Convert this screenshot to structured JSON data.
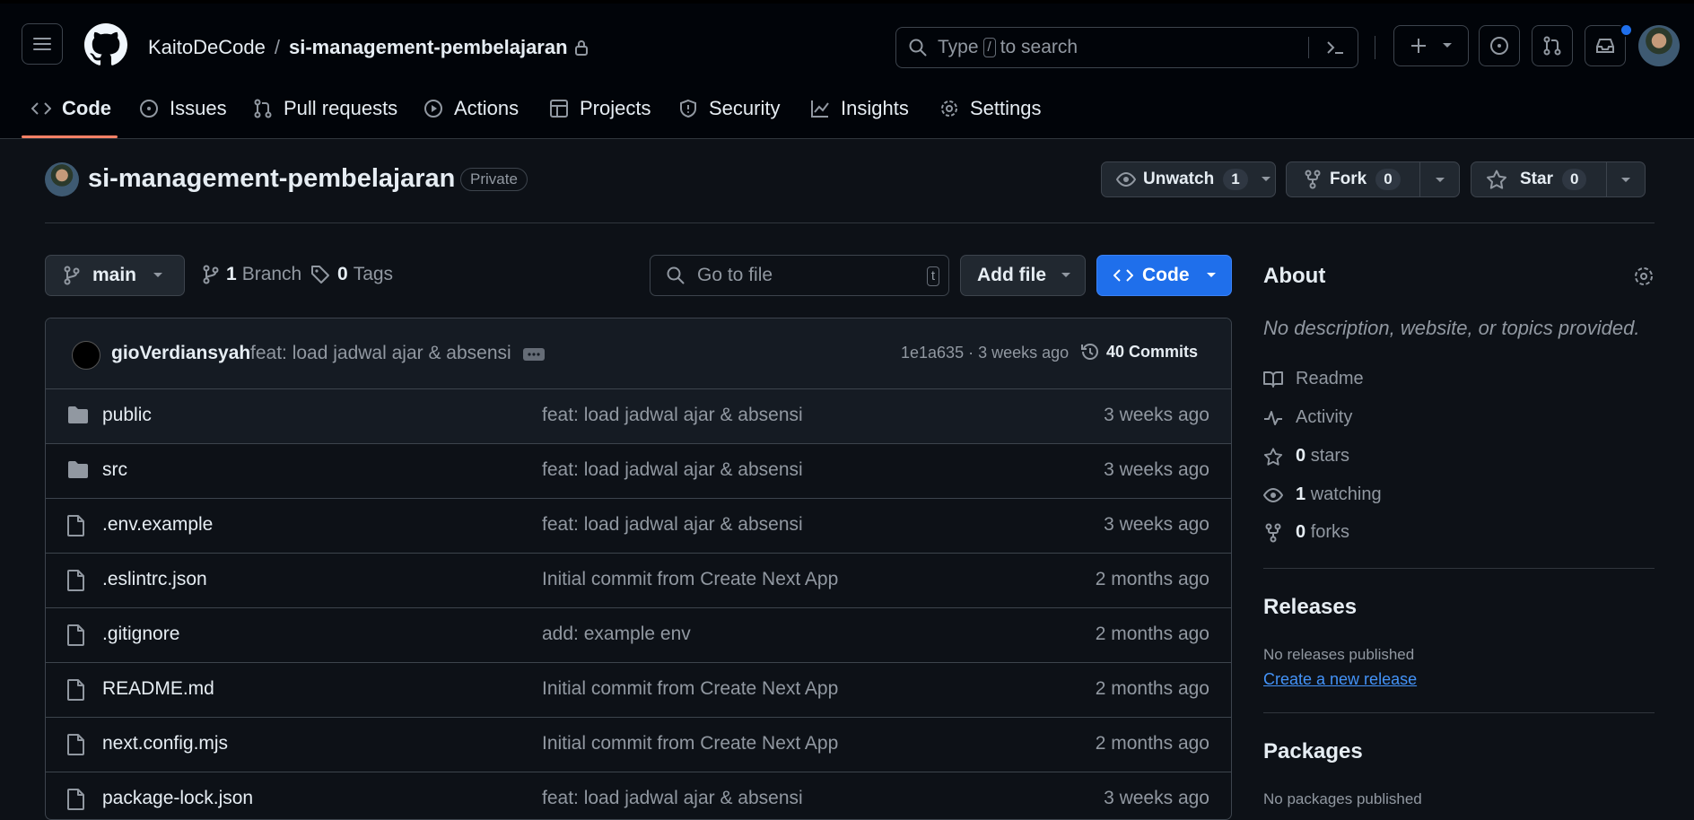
{
  "header": {
    "owner": "KaitoDeCode",
    "slash": "/",
    "repo": "si-management-pembelajaran",
    "search_pre": "Type",
    "search_key": "/",
    "search_post": "to search"
  },
  "tabs": [
    {
      "label": "Code",
      "icon": "code-icon"
    },
    {
      "label": "Issues",
      "icon": "issue-icon"
    },
    {
      "label": "Pull requests",
      "icon": "pull-request-icon"
    },
    {
      "label": "Actions",
      "icon": "play-icon"
    },
    {
      "label": "Projects",
      "icon": "table-icon"
    },
    {
      "label": "Security",
      "icon": "shield-icon"
    },
    {
      "label": "Insights",
      "icon": "graph-icon"
    },
    {
      "label": "Settings",
      "icon": "gear-icon"
    }
  ],
  "repo": {
    "title": "si-management-pembelajaran",
    "visibility": "Private",
    "unwatch_label": "Unwatch",
    "unwatch_count": "1",
    "fork_label": "Fork",
    "fork_count": "0",
    "star_label": "Star",
    "star_count": "0"
  },
  "toolbar": {
    "branch": "main",
    "branch_count": "1",
    "branch_label": "Branch",
    "tag_count": "0",
    "tag_label": "Tags",
    "goto_placeholder": "Go to file",
    "goto_key": "t",
    "add_file": "Add file",
    "code": "Code"
  },
  "commit": {
    "author": "gioVerdiansyah",
    "message": "feat: load jadwal ajar & absensi",
    "hash_time": "1e1a635 · 3 weeks ago",
    "commits_count": "40",
    "commits_label": "Commits"
  },
  "files": [
    {
      "name": "public",
      "type": "folder",
      "message": "feat: load jadwal ajar & absensi",
      "date": "3 weeks ago"
    },
    {
      "name": "src",
      "type": "folder",
      "message": "feat: load jadwal ajar & absensi",
      "date": "3 weeks ago"
    },
    {
      "name": ".env.example",
      "type": "file",
      "message": "feat: load jadwal ajar & absensi",
      "date": "3 weeks ago"
    },
    {
      "name": ".eslintrc.json",
      "type": "file",
      "message": "Initial commit from Create Next App",
      "date": "2 months ago"
    },
    {
      "name": ".gitignore",
      "type": "file",
      "message": "add: example env",
      "date": "2 months ago"
    },
    {
      "name": "README.md",
      "type": "file",
      "message": "Initial commit from Create Next App",
      "date": "2 months ago"
    },
    {
      "name": "next.config.mjs",
      "type": "file",
      "message": "Initial commit from Create Next App",
      "date": "2 months ago"
    },
    {
      "name": "package-lock.json",
      "type": "file",
      "message": "feat: load jadwal ajar & absensi",
      "date": "3 weeks ago"
    }
  ],
  "about": {
    "title": "About",
    "description": "No description, website, or topics provided.",
    "readme": "Readme",
    "activity": "Activity",
    "stars_count": "0",
    "stars_label": "stars",
    "watching_count": "1",
    "watching_label": "watching",
    "forks_count": "0",
    "forks_label": "forks"
  },
  "releases": {
    "title": "Releases",
    "none": "No releases published",
    "create_link": "Create a new release"
  },
  "packages": {
    "title": "Packages",
    "none": "No packages published"
  },
  "colors": {
    "accent_blue": "#1f6feb",
    "link": "#4493f8",
    "tab_underline": "#f78166",
    "bg": "#0d1117",
    "header_bg": "#010409"
  }
}
